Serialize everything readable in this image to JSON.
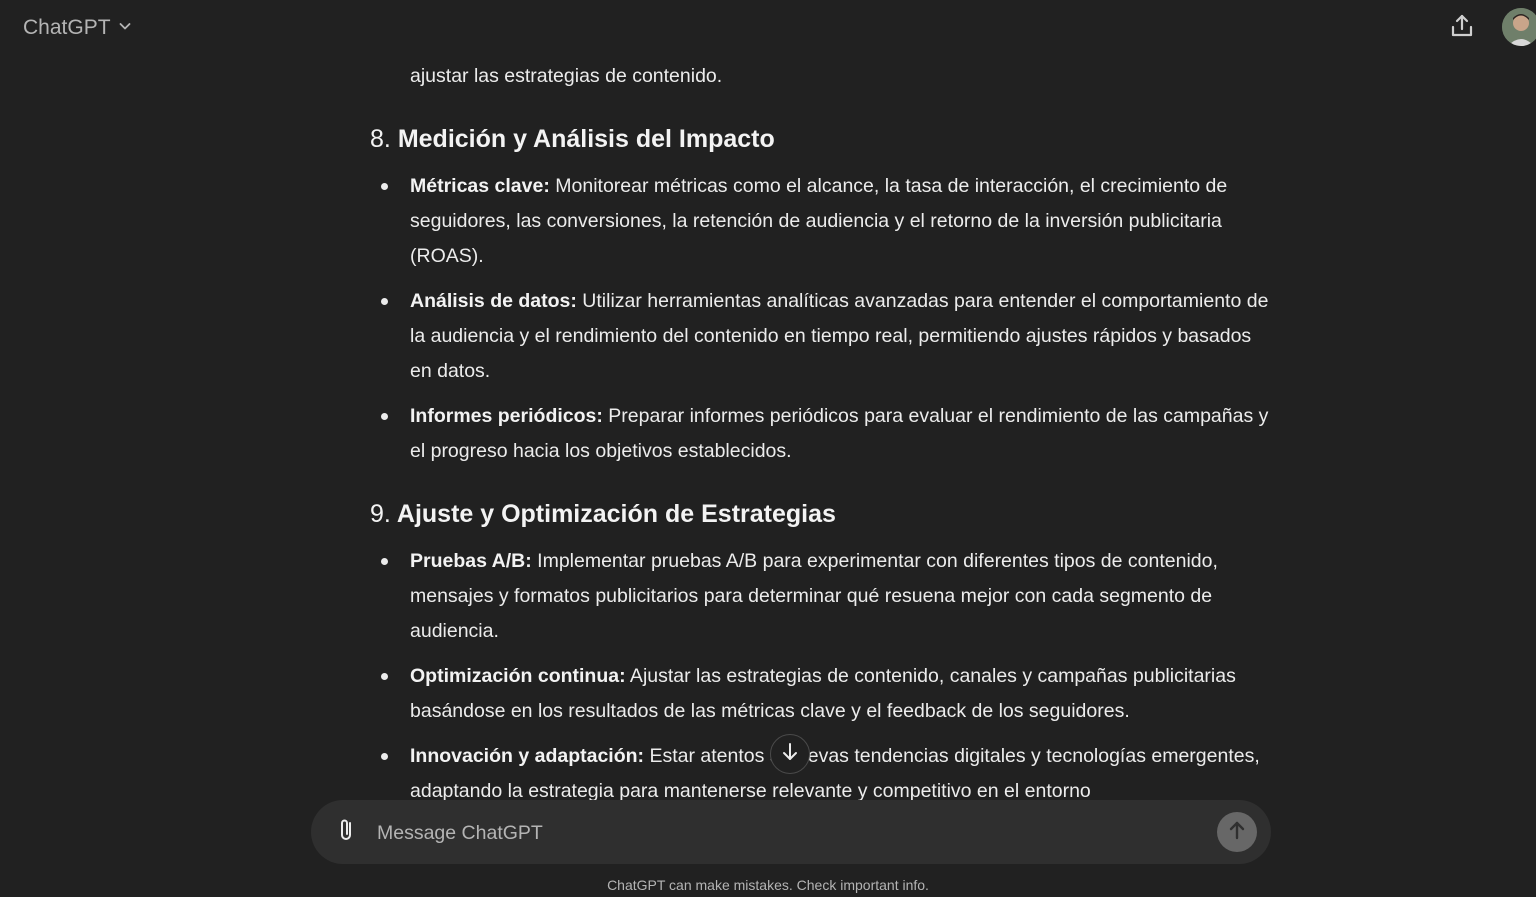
{
  "header": {
    "model_name": "ChatGPT"
  },
  "message": {
    "lead_text": "ajustar las estrategias de contenido.",
    "sections": [
      {
        "number": "8.",
        "title": "Medición y Análisis del Impacto",
        "items": [
          {
            "label": "Métricas clave:",
            "text": " Monitorear métricas como el alcance, la tasa de interacción, el crecimiento de seguidores, las conversiones, la retención de audiencia y el retorno de la inversión publicitaria (ROAS)."
          },
          {
            "label": "Análisis de datos:",
            "text": " Utilizar herramientas analíticas avanzadas para entender el comportamiento de la audiencia y el rendimiento del contenido en tiempo real, permitiendo ajustes rápidos y basados en datos."
          },
          {
            "label": "Informes periódicos:",
            "text": " Preparar informes periódicos para evaluar el rendimiento de las campañas y el progreso hacia los objetivos establecidos."
          }
        ]
      },
      {
        "number": "9.",
        "title": "Ajuste y Optimización de Estrategias",
        "items": [
          {
            "label": "Pruebas A/B:",
            "text": " Implementar pruebas A/B para experimentar con diferentes tipos de contenido, mensajes y formatos publicitarios para determinar qué resuena mejor con cada segmento de audiencia."
          },
          {
            "label": "Optimización continua:",
            "text": " Ajustar las estrategias de contenido, canales y campañas publicitarias basándose en los resultados de las métricas clave y el feedback de los seguidores."
          },
          {
            "label": "Innovación y adaptación:",
            "text": " Estar atentos a nuevas tendencias digitales y tecnologías emergentes, adaptando la estrategia para mantenerse relevante y competitivo en el entorno"
          }
        ]
      }
    ]
  },
  "composer": {
    "placeholder": "Message ChatGPT"
  },
  "footer": {
    "disclaimer": "ChatGPT can make mistakes. Check important info."
  },
  "icons": {
    "model_dropdown": "chevron-down-icon",
    "share": "share-icon",
    "scroll_down": "arrow-down-icon",
    "attach": "paperclip-icon",
    "send": "arrow-up-icon"
  },
  "colors": {
    "background": "#212121",
    "composer_bg": "#2f2f2f",
    "text": "#ececec",
    "muted_text": "#b4b4b4",
    "send_button": "#676767"
  }
}
